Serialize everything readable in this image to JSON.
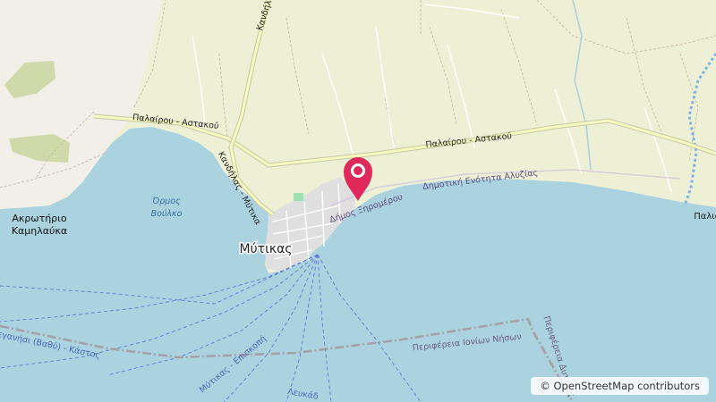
{
  "map": {
    "colors": {
      "water": "#aad3df",
      "land": "#f2efe9",
      "farmland": "#eef0d5",
      "urban": "#e0dfdf",
      "road_fill": "#f7fabf",
      "road_casing": "#c6c9a4",
      "track": "#ac8e7a",
      "ferry": "#5a7bd6",
      "admin": "#a59ba3",
      "marker": "#e0285a"
    },
    "labels": {
      "akrotirio": "Ακρωτήριο",
      "kamilavka": "Καμηλαύκα",
      "ormos": "Όρμος",
      "voulko": "Βούλκο",
      "mytikas": "Μύτικας",
      "road_palairou_astakou_west": "Παλαίρου - Αστακού",
      "road_palairou_astakou_east": "Παλαίρου - Αστακού",
      "road_kandila_mytikas": "Κανδήλας - Μύτικα",
      "road_kandila_top": "Κανδήλ",
      "dimos_xiromerou": "Δήμος Ξηρομέρου",
      "dimotiki_enotita": "Δημοτική Ενότητα Αλυζίας",
      "perifereia_ionion": "Περιφέρεια Ιονίων Νήσων",
      "perifereia_dytikis": "Περιφέρεια Δυτικής",
      "megannisi_ferry": "Μεγανήσι (Βαθύ) - Κάστος",
      "mytikas_epano": "Μύτικας - Επισκοπή",
      "lefkada": "Λευκάδ",
      "palio": "Παλιο"
    },
    "marker": {
      "icon": "map-pin-icon"
    }
  },
  "attribution": "© OpenStreetMap contributors"
}
